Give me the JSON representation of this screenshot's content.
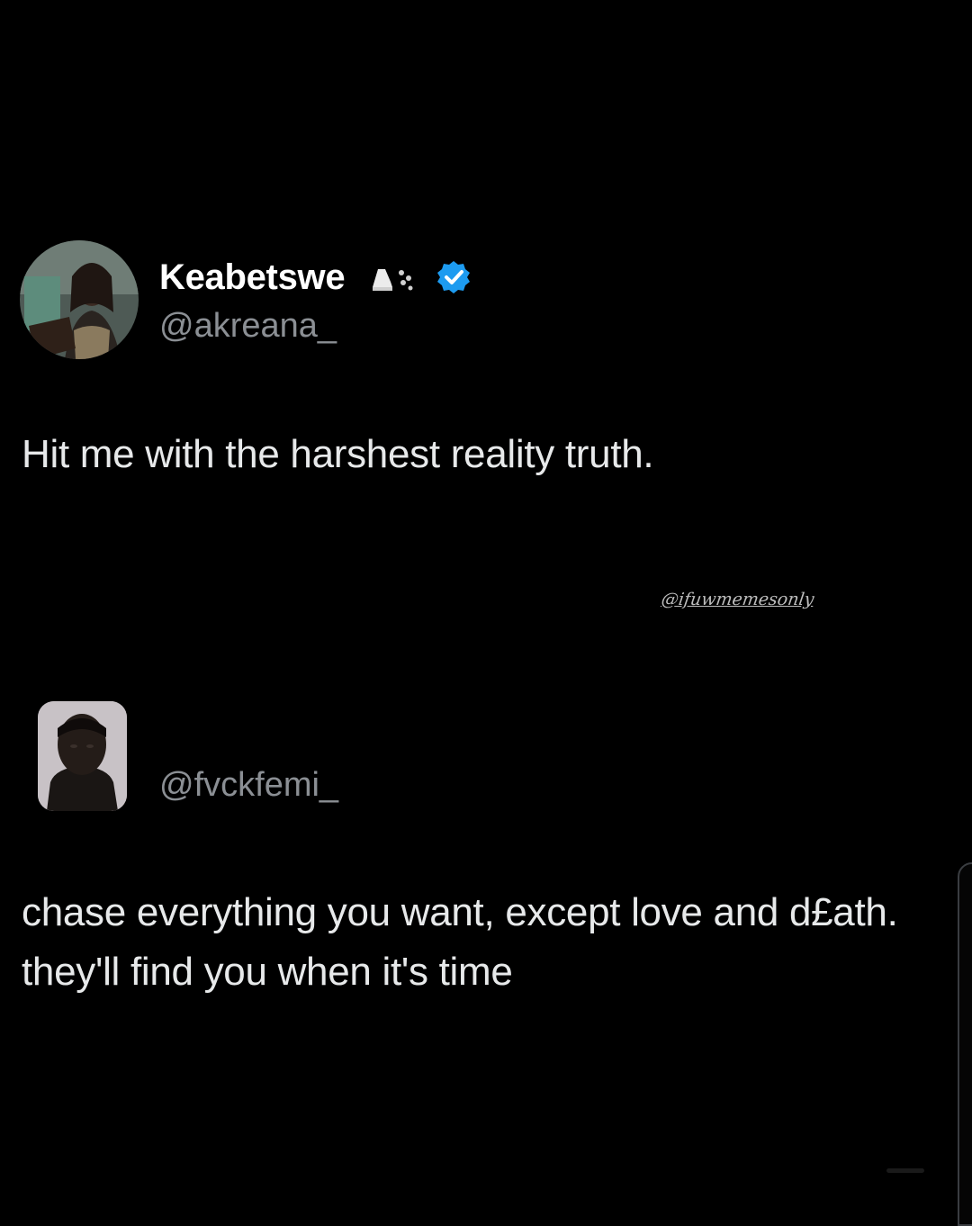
{
  "original_post": {
    "display_name": "Keabetswe",
    "name_emoji": "running-shoe-dash-emoji",
    "verified": true,
    "handle": "@akreana_",
    "text": "Hit me with the harshest reality truth."
  },
  "watermark": "@ifuwmemesonly",
  "reply_post": {
    "handle": "@fvckfemi_",
    "text": "chase everything you want, except love and d£ath. they'll find you when it's time"
  },
  "colors": {
    "background": "#000000",
    "text": "#e7e9ea",
    "handle": "#8b8f94",
    "verified": "#1d9bf0"
  }
}
